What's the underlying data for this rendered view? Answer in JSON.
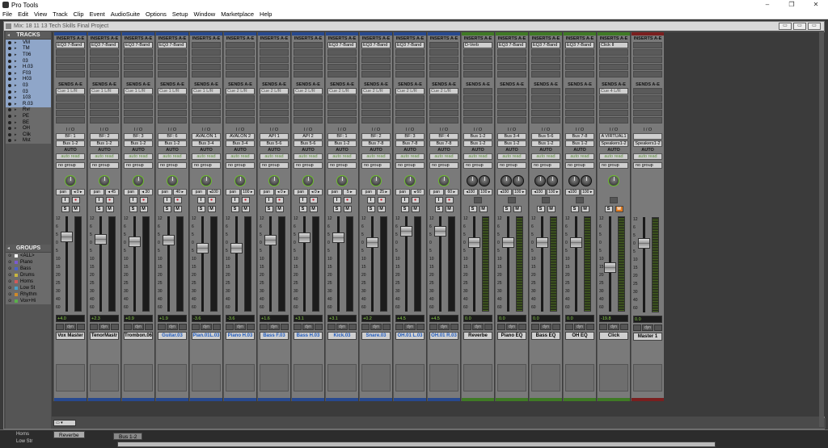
{
  "app": {
    "title": "Pro Tools",
    "window_controls": [
      "–",
      "❐",
      "✕"
    ]
  },
  "menu": [
    "File",
    "Edit",
    "View",
    "Track",
    "Clip",
    "Event",
    "AudioSuite",
    "Options",
    "Setup",
    "Window",
    "Marketplace",
    "Help"
  ],
  "mix": {
    "title": "Mix: 18 11 13 Tech Skills Final Project",
    "controls": [
      "▭",
      "▭",
      "▭"
    ]
  },
  "tracks_header": "TRACKS",
  "groups_header": "GROUPS",
  "tracks": [
    {
      "name": "VM",
      "sel": true
    },
    {
      "name": "TM",
      "sel": true
    },
    {
      "name": "T06",
      "sel": true
    },
    {
      "name": "03",
      "sel": true
    },
    {
      "name": "H.03",
      "sel": true
    },
    {
      "name": "F03",
      "sel": true
    },
    {
      "name": "H03",
      "sel": true
    },
    {
      "name": "03",
      "sel": true
    },
    {
      "name": "03",
      "sel": true
    },
    {
      "name": "103",
      "sel": true
    },
    {
      "name": "R.03",
      "sel": true
    },
    {
      "name": "Rvr",
      "sel": false
    },
    {
      "name": "PE",
      "sel": false
    },
    {
      "name": "BE",
      "sel": false
    },
    {
      "name": "OH",
      "sel": false
    },
    {
      "name": "Clik",
      "sel": false
    },
    {
      "name": "Mst",
      "sel": false
    }
  ],
  "groups": [
    {
      "name": "<ALL>",
      "color": "#fff"
    },
    {
      "name": "Piano",
      "color": "#7a5bd0"
    },
    {
      "name": "Bass",
      "color": "#4a62c8"
    },
    {
      "name": "Drums",
      "color": "#c8b640"
    },
    {
      "name": "Horns",
      "color": "#d05a5a"
    },
    {
      "name": "Low St",
      "color": "#4aa0c8"
    },
    {
      "name": "Rhythm",
      "color": "#d08a2a"
    },
    {
      "name": "Vox+Hi",
      "color": "#5ab04a"
    }
  ],
  "labels": {
    "inserts": "INSERTS A-E",
    "sends": "SENDS A-E",
    "io": "I / O",
    "auto": "AUTO",
    "dyn": "dyn"
  },
  "strips": [
    {
      "name": "Vox Master",
      "band": "#27498f",
      "insert": "EQ3 7-Band",
      "send": "Cue 1 L/R",
      "in": "BF: 1",
      "out": "Bus 1-2",
      "auto": "auto read",
      "group": "no group",
      "pan": [
        "◂ 0 ▸"
      ],
      "vol": "+4.0",
      "blue": false,
      "fader": 0.18,
      "meter": false
    },
    {
      "name": "TenorMastr",
      "band": "#27498f",
      "insert": "EQ3 7-Band",
      "send": "Cue 1 L/R",
      "in": "BF: 2",
      "out": "Bus 1-2",
      "auto": "auto read",
      "group": "no group",
      "pan": [
        "◂ 45"
      ],
      "vol": "+2.3",
      "blue": false,
      "fader": 0.21,
      "meter": false
    },
    {
      "name": "Trombon.06",
      "band": "#27498f",
      "insert": "EQ3 7-Band",
      "send": "Cue 1 L/R",
      "in": "BF: 3",
      "out": "Bus 1-2",
      "auto": "auto read",
      "group": "no group",
      "pan": [
        "◂ 30"
      ],
      "vol": "+0.9",
      "blue": false,
      "fader": 0.24,
      "meter": false
    },
    {
      "name": "Guitar.03",
      "band": "#27498f",
      "insert": "EQ3 7-Band",
      "send": "Cue 1 L/R",
      "in": "BF: 6",
      "out": "Bus 1-2",
      "auto": "auto read",
      "group": "no group",
      "pan": [
        "40 ▸"
      ],
      "vol": "+1.9",
      "blue": true,
      "fader": 0.22,
      "meter": false
    },
    {
      "name": "Pian.01L.03",
      "band": "#27498f",
      "insert": "",
      "send": "Cue 1 L/R",
      "in": "AVALON 1",
      "out": "Bus 3-4",
      "auto": "auto read",
      "group": "no group",
      "pan": [
        "◂100"
      ],
      "vol": "-3.6",
      "blue": true,
      "fader": 0.32,
      "meter": false
    },
    {
      "name": "Piano H.03",
      "band": "#27498f",
      "insert": "",
      "send": "Cue 2 L/R",
      "in": "AVALON 2",
      "out": "Bus 3-4",
      "auto": "auto read",
      "group": "no group",
      "pan": [
        "100 ▸"
      ],
      "vol": "-3.6",
      "blue": true,
      "fader": 0.32,
      "meter": false
    },
    {
      "name": "Bass F.03",
      "band": "#27498f",
      "insert": "",
      "send": "Cue 2 L/R",
      "in": "API 1",
      "out": "Bus 5-6",
      "auto": "auto read",
      "group": "no group",
      "pan": [
        "◂ 0 ▸"
      ],
      "vol": "+1.6",
      "blue": true,
      "fader": 0.22,
      "meter": false
    },
    {
      "name": "Bass H.03",
      "band": "#27498f",
      "insert": "",
      "send": "Cue 2 L/R",
      "in": "API 2",
      "out": "Bus 5-6",
      "auto": "auto read",
      "group": "no group",
      "pan": [
        "◂ 0 ▸"
      ],
      "vol": "+3.1",
      "blue": true,
      "fader": 0.19,
      "meter": false
    },
    {
      "name": "Kick.03",
      "band": "#27498f",
      "insert": "EQ3 7-Band",
      "send": "Cue 2 L/R",
      "in": "BF: 1",
      "out": "Bus 1-2",
      "auto": "auto read",
      "group": "no group",
      "pan": [
        "5 ▸"
      ],
      "vol": "+3.1",
      "blue": true,
      "fader": 0.19,
      "meter": false
    },
    {
      "name": "Snare.03",
      "band": "#27498f",
      "insert": "EQ3 7-Band",
      "send": "Cue 2 L/R",
      "in": "BF: 2",
      "out": "Bus 7-8",
      "auto": "auto read",
      "group": "no group",
      "pan": [
        "25 ▸"
      ],
      "vol": "+0.2",
      "blue": true,
      "fader": 0.25,
      "meter": false
    },
    {
      "name": "OH.01 L.03",
      "band": "#27498f",
      "insert": "EQ3 7-Band",
      "send": "Cue 2 L/R",
      "in": "BF: 3",
      "out": "Bus 7-8",
      "auto": "auto read",
      "group": "no group",
      "pan": [
        "◂ 60"
      ],
      "vol": "+4.5",
      "blue": true,
      "fader": 0.12,
      "meter": false
    },
    {
      "name": "OH.01 R.03",
      "band": "#27498f",
      "insert": "",
      "send": "Cue 2 L/R",
      "in": "BF: 4",
      "out": "Bus 7-8",
      "auto": "auto read",
      "group": "no group",
      "pan": [
        "60 ▸"
      ],
      "vol": "+4.5",
      "blue": true,
      "fader": 0.12,
      "meter": false
    },
    {
      "name": "Reverbe",
      "band": "#3f7a25",
      "insert": "D-Verb",
      "send": "",
      "in": "Bus 1-2",
      "out": "Bus 1-2",
      "auto": "auto read",
      "group": "no group",
      "pan": [
        "◂100",
        "100 ▸"
      ],
      "vol": "0.0",
      "blue": false,
      "fader": 0.25,
      "meter": true,
      "stereo": true
    },
    {
      "name": "Piano EQ",
      "band": "#3f7a25",
      "insert": "EQ3 7-Band",
      "send": "",
      "in": "Bus 3-4",
      "out": "Bus 1-2",
      "auto": "auto read",
      "group": "no group",
      "pan": [
        "◂100",
        "100 ▸"
      ],
      "vol": "0.0",
      "blue": false,
      "fader": 0.25,
      "meter": true,
      "stereo": true
    },
    {
      "name": "Bass EQ",
      "band": "#3f7a25",
      "insert": "EQ3 7-Band",
      "send": "",
      "in": "Bus 5-6",
      "out": "Bus 1-2",
      "auto": "auto read",
      "group": "no group",
      "pan": [
        "◂100",
        "100 ▸"
      ],
      "vol": "0.0",
      "blue": false,
      "fader": 0.25,
      "meter": true,
      "stereo": true
    },
    {
      "name": "OH EQ",
      "band": "#3f7a25",
      "insert": "EQ3 7-Band",
      "send": "",
      "in": "Bus 7-8",
      "out": "Bus 1-2",
      "auto": "auto read",
      "group": "no group",
      "pan": [
        "◂100",
        "100 ▸"
      ],
      "vol": "0.0",
      "blue": false,
      "fader": 0.25,
      "meter": true,
      "stereo": true
    },
    {
      "name": "Click",
      "band": "#3f7a25",
      "insert": "Click II",
      "send": "Cue 4 L/R",
      "in": "A VIRTUAL1",
      "out": "Speakers1-2",
      "auto": "auto read",
      "group": "no group",
      "pan": [],
      "vol": "-19.8",
      "blue": false,
      "fader": 0.55,
      "meter": true,
      "mute": true
    },
    {
      "name": "Master 1",
      "band": "#7a1f1f",
      "insert": "",
      "send": "",
      "in": "",
      "out": "Speakers1-2",
      "auto": "auto read",
      "group": "no group",
      "pan": [],
      "vol": "0.0",
      "blue": false,
      "fader": 0.25,
      "meter": true,
      "master": true
    }
  ],
  "scale": [
    "12",
    "6",
    "5",
    "0",
    "5",
    "10",
    "15",
    "20",
    "25",
    "30",
    "40",
    "60"
  ],
  "bottom": {
    "track1": "Horns",
    "track2": "Low Str",
    "reverb_label": "Reverbe",
    "bus": "Bus 1-2"
  }
}
